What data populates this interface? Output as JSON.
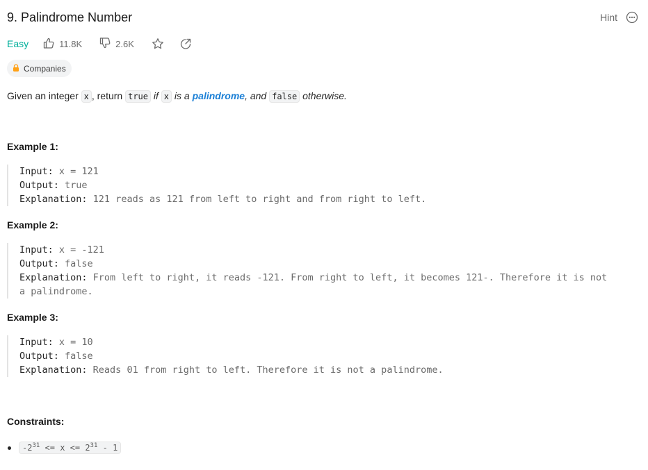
{
  "problem": {
    "title": "9. Palindrome Number",
    "hint_label": "Hint",
    "difficulty": "Easy",
    "likes": "11.8K",
    "dislikes": "2.6K",
    "companies_label": "Companies"
  },
  "description": {
    "p1": "Given an integer ",
    "code_x": "x",
    "p2": ", return ",
    "code_true": "true",
    "p3": " if ",
    "code_x2": "x",
    "p4": " is a ",
    "link": "palindrome",
    "p5": ", and ",
    "code_false": "false",
    "p6": " otherwise."
  },
  "examples": [
    {
      "title": "Example 1:",
      "input_label": "Input:",
      "input": " x = 121",
      "output_label": "Output:",
      "output": " true",
      "explanation_label": "Explanation:",
      "explanation": " 121 reads as 121 from left to right and from right to left."
    },
    {
      "title": "Example 2:",
      "input_label": "Input:",
      "input": " x = -121",
      "output_label": "Output:",
      "output": " false",
      "explanation_label": "Explanation:",
      "explanation": " From left to right, it reads -121. From right to left, it becomes 121-. Therefore it is not",
      "explanation_cont": "a palindrome."
    },
    {
      "title": "Example 3:",
      "input_label": "Input:",
      "input": " x = 10",
      "output_label": "Output:",
      "output": " false",
      "explanation_label": "Explanation:",
      "explanation": " Reads 01 from right to left. Therefore it is not a palindrome."
    }
  ],
  "constraints": {
    "title": "Constraints:",
    "c1_part1": "-2",
    "c1_exp1": "31",
    "c1_part2": " <= x <= 2",
    "c1_exp2": "31",
    "c1_part3": " - 1"
  },
  "colors": {
    "easy": "#00af9b",
    "link": "#1a7fd6",
    "lock": "#ffa116"
  },
  "icons": [
    "thumb-up-icon",
    "thumb-down-icon",
    "star-icon",
    "share-icon",
    "more-icon",
    "lock-icon"
  ]
}
